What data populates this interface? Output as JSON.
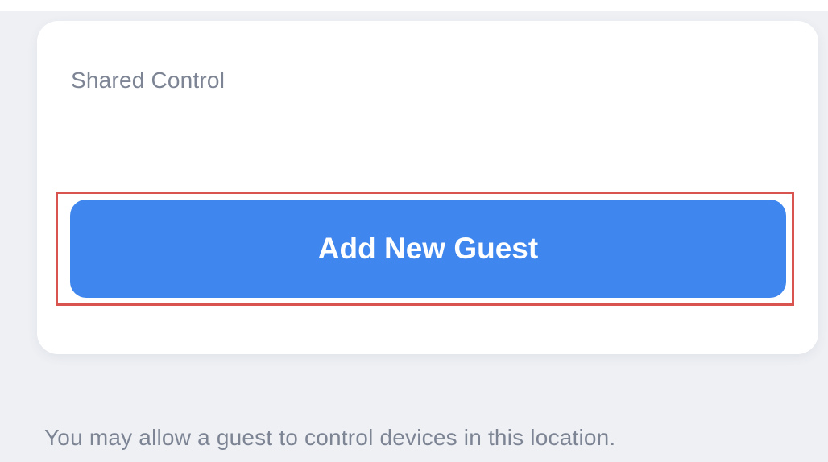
{
  "shared_control": {
    "title": "Shared Control",
    "add_guest_button_label": "Add New Guest"
  },
  "helper_text": "You may allow a guest to control devices in this location.",
  "colors": {
    "screen_background": "#eef0f4",
    "card_background": "#ffffff",
    "button_background": "#3f87ee",
    "button_text": "#ffffff",
    "secondary_text": "#7d8595",
    "highlight_outline": "#d9534f"
  }
}
